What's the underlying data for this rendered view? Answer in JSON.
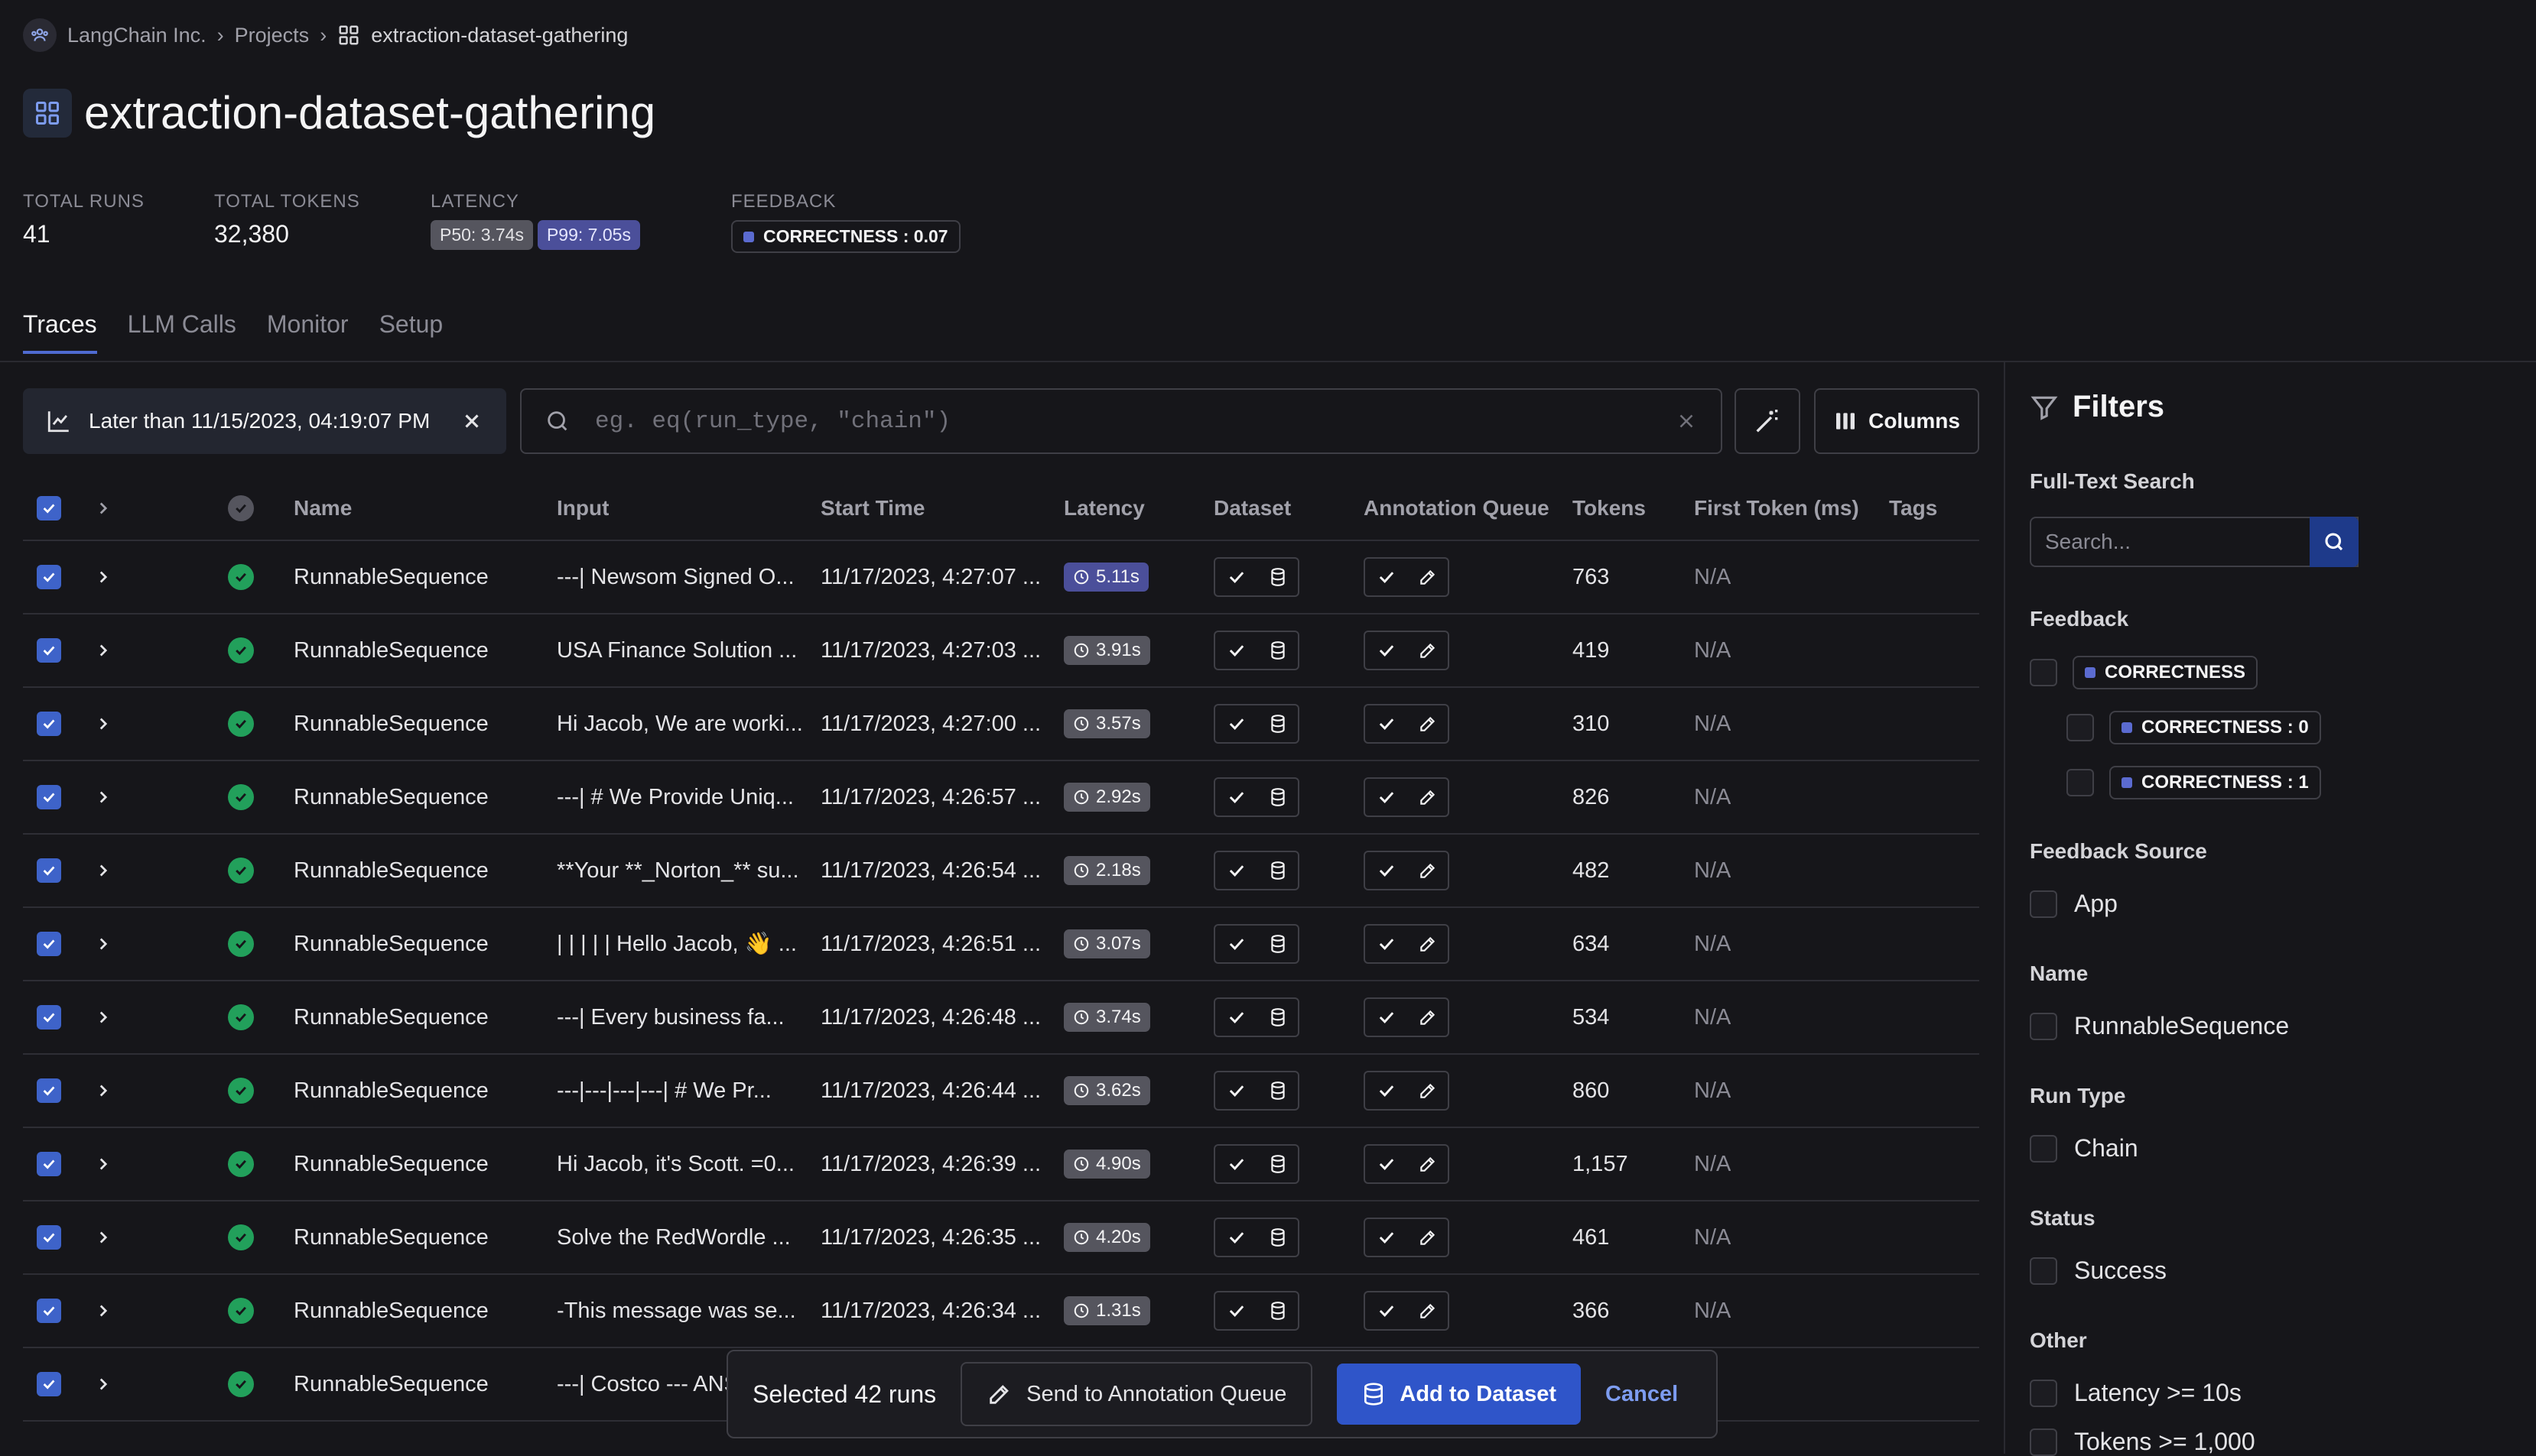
{
  "breadcrumb": {
    "org": "LangChain Inc.",
    "projects": "Projects",
    "current": "extraction-dataset-gathering"
  },
  "project_title": "extraction-dataset-gathering",
  "stats": {
    "total_runs_label": "TOTAL RUNS",
    "total_runs": "41",
    "total_tokens_label": "TOTAL TOKENS",
    "total_tokens": "32,380",
    "latency_label": "LATENCY",
    "p50": "P50: 3.74s",
    "p99": "P99: 7.05s",
    "feedback_label": "FEEDBACK",
    "feedback_badge": "CORRECTNESS : 0.07"
  },
  "tabs": [
    {
      "label": "Traces",
      "active": true
    },
    {
      "label": "LLM Calls"
    },
    {
      "label": "Monitor"
    },
    {
      "label": "Setup"
    }
  ],
  "toolbar": {
    "date_filter": "Later than 11/15/2023, 04:19:07 PM",
    "search_placeholder": "eg. eq(run_type, \"chain\")",
    "columns_label": "Columns"
  },
  "table": {
    "headers": {
      "name": "Name",
      "input": "Input",
      "start_time": "Start Time",
      "latency": "Latency",
      "dataset": "Dataset",
      "annotation_queue": "Annotation Queue",
      "tokens": "Tokens",
      "first_token": "First Token (ms)",
      "tags": "Tags"
    },
    "rows": [
      {
        "name": "RunnableSequence",
        "input": "---| Newsom Signed O...",
        "start": "11/17/2023, 4:27:07 ...",
        "latency": "5.11s",
        "hi": true,
        "tokens": "763",
        "first": "N/A"
      },
      {
        "name": "RunnableSequence",
        "input": "USA Finance Solution ...",
        "start": "11/17/2023, 4:27:03 ...",
        "latency": "3.91s",
        "tokens": "419",
        "first": "N/A"
      },
      {
        "name": "RunnableSequence",
        "input": "Hi Jacob, We are worki...",
        "start": "11/17/2023, 4:27:00 ...",
        "latency": "3.57s",
        "tokens": "310",
        "first": "N/A"
      },
      {
        "name": "RunnableSequence",
        "input": "---| # We Provide Uniq...",
        "start": "11/17/2023, 4:26:57 ...",
        "latency": "2.92s",
        "tokens": "826",
        "first": "N/A"
      },
      {
        "name": "RunnableSequence",
        "input": "**Your **_Norton_** su...",
        "start": "11/17/2023, 4:26:54 ...",
        "latency": "2.18s",
        "tokens": "482",
        "first": "N/A"
      },
      {
        "name": "RunnableSequence",
        "input": "| | | | | Hello Jacob, 👋 ...",
        "start": "11/17/2023, 4:26:51 ...",
        "latency": "3.07s",
        "tokens": "634",
        "first": "N/A"
      },
      {
        "name": "RunnableSequence",
        "input": "---| Every business fa...",
        "start": "11/17/2023, 4:26:48 ...",
        "latency": "3.74s",
        "tokens": "534",
        "first": "N/A"
      },
      {
        "name": "RunnableSequence",
        "input": "---|---|---|---| # We Pr...",
        "start": "11/17/2023, 4:26:44 ...",
        "latency": "3.62s",
        "tokens": "860",
        "first": "N/A"
      },
      {
        "name": "RunnableSequence",
        "input": "Hi Jacob, it's Scott. =0...",
        "start": "11/17/2023, 4:26:39 ...",
        "latency": "4.90s",
        "tokens": "1,157",
        "first": "N/A"
      },
      {
        "name": "RunnableSequence",
        "input": "Solve the RedWordle ...",
        "start": "11/17/2023, 4:26:35 ...",
        "latency": "4.20s",
        "tokens": "461",
        "first": "N/A"
      },
      {
        "name": "RunnableSequence",
        "input": "-This message was se...",
        "start": "11/17/2023, 4:26:34 ...",
        "latency": "1.31s",
        "tokens": "366",
        "first": "N/A"
      },
      {
        "name": "RunnableSequence",
        "input": "---| Costco --- ANS",
        "start": "",
        "latency": "",
        "tokens": "",
        "first": "A"
      }
    ]
  },
  "filters": {
    "title": "Filters",
    "full_text_label": "Full-Text Search",
    "search_placeholder": "Search...",
    "feedback_label": "Feedback",
    "feedback_options": [
      "CORRECTNESS",
      "CORRECTNESS : 0",
      "CORRECTNESS : 1"
    ],
    "feedback_source_label": "Feedback Source",
    "feedback_source": "App",
    "name_label": "Name",
    "name_value": "RunnableSequence",
    "run_type_label": "Run Type",
    "run_type_value": "Chain",
    "status_label": "Status",
    "status_value": "Success",
    "other_label": "Other",
    "other_options": [
      "Latency >= 10s",
      "Tokens >= 1,000"
    ]
  },
  "bulk": {
    "selected": "Selected 42 runs",
    "send": "Send to Annotation Queue",
    "add": "Add to Dataset",
    "cancel": "Cancel"
  },
  "colors": {
    "accent": "#3e63c9",
    "success": "#22a05b",
    "bg": "#16161a"
  }
}
